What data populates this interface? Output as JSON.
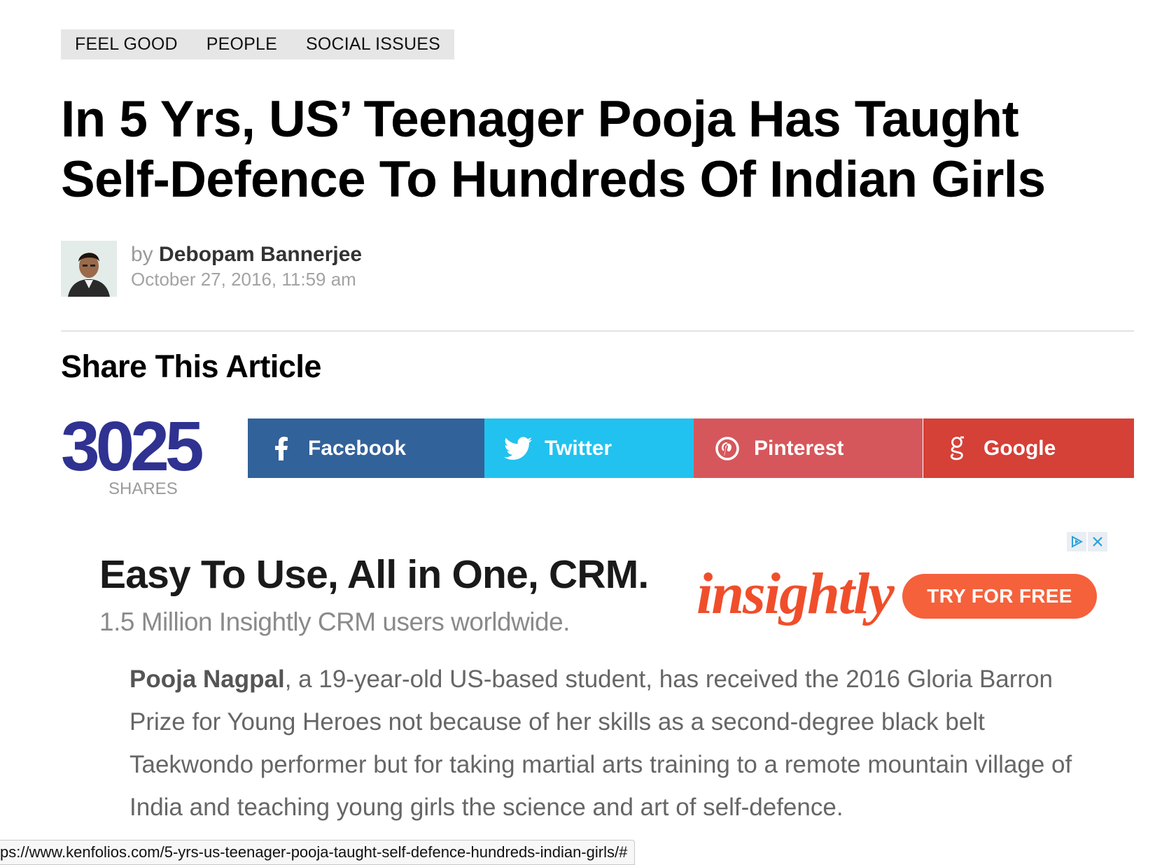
{
  "tags": [
    "FEEL GOOD",
    "PEOPLE",
    "SOCIAL ISSUES"
  ],
  "headline": {
    "line1": "In 5 Yrs, US’ Teenager Pooja Has Taught",
    "line2": "Self-Defence To Hundreds Of Indian Girls"
  },
  "author": {
    "by": "by",
    "name": "Debopam Bannerjee",
    "date": "October 27, 2016, 11:59 am"
  },
  "share": {
    "title": "Share This Article",
    "count": "3025",
    "count_label": "SHARES",
    "buttons": {
      "facebook": "Facebook",
      "twitter": "Twitter",
      "pinterest": "Pinterest",
      "google": "Google"
    },
    "colors": {
      "facebook": "#32629a",
      "twitter": "#21c2ef",
      "pinterest": "#d5575c",
      "google": "#d54037",
      "count": "#2f3291"
    }
  },
  "ad": {
    "headline": "Easy To Use, All in One, CRM.",
    "subline": "1.5 Million Insightly CRM users worldwide.",
    "brand": "insightly",
    "cta": "TRY FOR FREE",
    "icons": [
      "adchoices-icon",
      "close-icon"
    ]
  },
  "article": {
    "lead_name": "Pooja Nagpal",
    "lead_rest": ", a 19-year-old US-based student, has received the 2016 Gloria Barron Prize for Young Heroes not because of her skills as a second-degree black belt Taekwondo performer but for taking martial arts training to a remote mountain village of India and teaching young girls the science and art of self-defence."
  },
  "status_bar": {
    "url": "ps://www.kenfolios.com/5-yrs-us-teenager-pooja-taught-self-defence-hundreds-indian-girls/#"
  }
}
